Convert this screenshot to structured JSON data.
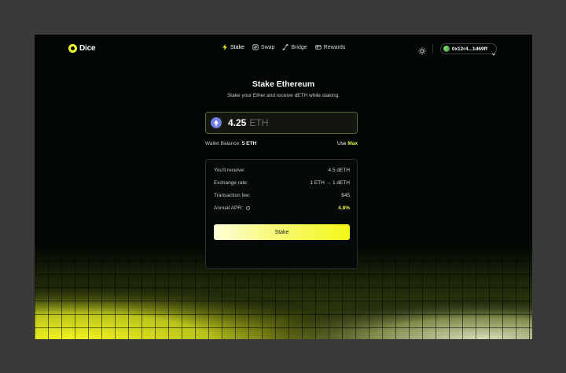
{
  "brand": {
    "name": "Dice",
    "accent": "#f3f728"
  },
  "nav": {
    "items": [
      {
        "label": "Stake",
        "icon": "bolt-icon",
        "active": true
      },
      {
        "label": "Swap",
        "icon": "swap-icon",
        "active": false
      },
      {
        "label": "Bridge",
        "icon": "bridge-icon",
        "active": false
      },
      {
        "label": "Rewards",
        "icon": "rewards-icon",
        "active": false
      }
    ]
  },
  "header": {
    "theme_icon": "sun-icon",
    "wallet_address": "0x12r4...1d69ff"
  },
  "page": {
    "title": "Stake Ethereum",
    "subtitle": "Stake your Ether and receive dETH while staking."
  },
  "amount": {
    "value": "4.25",
    "unit": "ETH",
    "icon": "ethereum-icon"
  },
  "balance": {
    "label": "Wallet Balance:",
    "value": "5 ETH",
    "use_label": "Use",
    "max_label": "Max"
  },
  "summary": {
    "rows": [
      {
        "label": "You'll receive:",
        "value": "4.5 dETH"
      },
      {
        "label": "Exchange rate:",
        "value": "1 ETH → 1 dETH"
      },
      {
        "label": "Transaction fee:",
        "value": "$45"
      },
      {
        "label": "Annual APR:",
        "value": "4.8%"
      }
    ],
    "button_label": "Stake"
  }
}
